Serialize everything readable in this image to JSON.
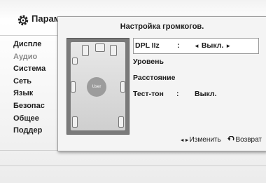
{
  "header": {
    "title": "Парам",
    "icon": "gear-icon"
  },
  "menu": {
    "items": [
      {
        "label": "Диспле"
      },
      {
        "label": "Аудио"
      },
      {
        "label": "Система"
      },
      {
        "label": "Сеть"
      },
      {
        "label": "Язык"
      },
      {
        "label": "Безопас"
      },
      {
        "label": "Общее"
      },
      {
        "label": "Поддер"
      }
    ]
  },
  "dialog": {
    "title": "Настройка громкогов.",
    "room": {
      "user_label": "User"
    },
    "options": [
      {
        "label": "DPL IIz",
        "colon": ":",
        "value": "Выкл.",
        "left_arrow": "◄",
        "right_arrow": "►"
      },
      {
        "label": "Уровень"
      },
      {
        "label": "Расстояние"
      },
      {
        "label": "Тест-тон",
        "colon": ":",
        "value": "Выкл."
      }
    ],
    "footer": {
      "change_label": "Изменить",
      "change_arrows": "◄►",
      "back_label": "Возврат",
      "back_icon": "return-arrow-icon"
    }
  }
}
